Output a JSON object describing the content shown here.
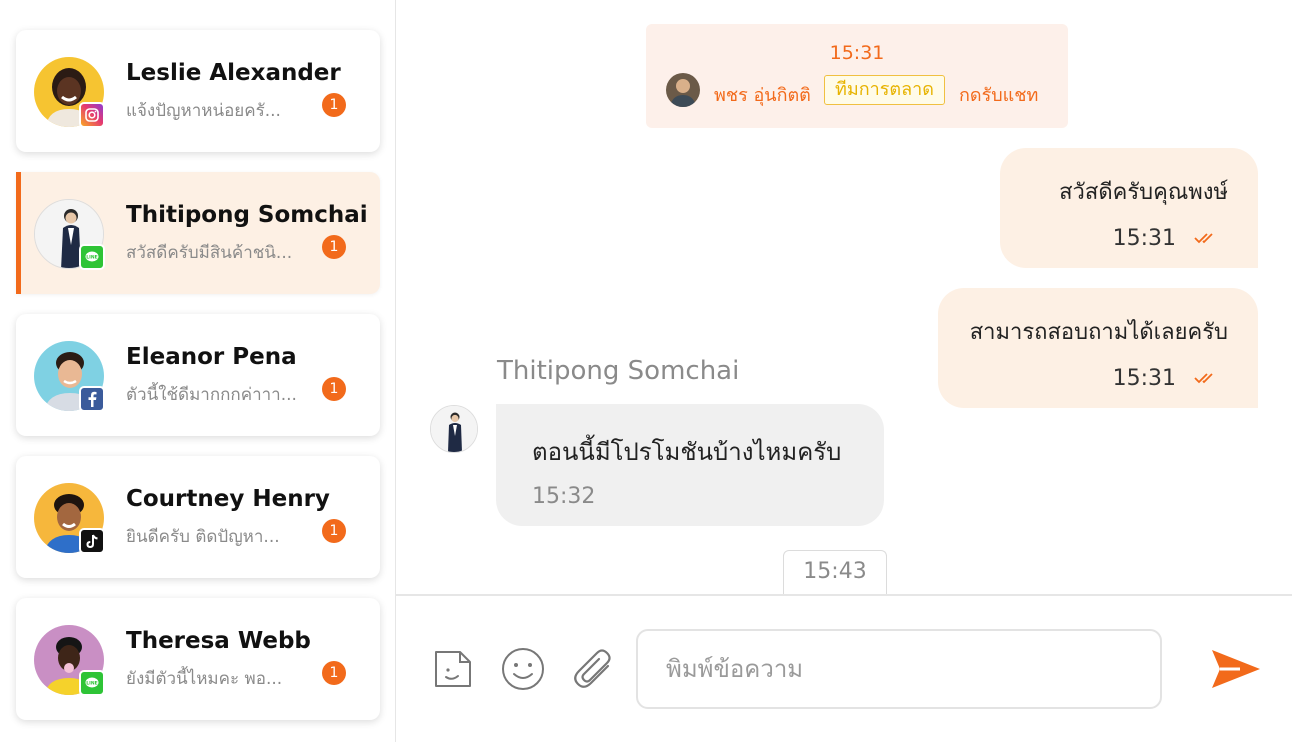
{
  "conversations": [
    {
      "name": "Leslie Alexander",
      "preview": "แจ้งปัญหาหน่อยครั...",
      "unread": "1",
      "channel": "instagram-icon"
    },
    {
      "name": "Thitipong Somchai",
      "preview": "สวัสดีครับมีสินค้าชนิ...",
      "unread": "1",
      "channel": "line-icon",
      "active": true
    },
    {
      "name": "Eleanor Pena",
      "preview": "ตัวนี้ใช้ดีมากกกค่าาา...",
      "unread": "1",
      "channel": "facebook-icon"
    },
    {
      "name": "Courtney Henry",
      "preview": "ยินดีครับ ติดปัญหา...",
      "unread": "1",
      "channel": "tiktok-icon"
    },
    {
      "name": "Theresa Webb",
      "preview": "ยังมีตัวนี้ไหมคะ พอ...",
      "unread": "1",
      "channel": "line-icon"
    }
  ],
  "system_notice": {
    "time": "15:31",
    "agent": "พชร อุ่นกิตติ",
    "team": "ทีมการตลาด",
    "action": "กดรับแชท"
  },
  "messages": {
    "outgoing": [
      {
        "text": "สวัสดีครับคุณพงษ์",
        "time": "15:31"
      },
      {
        "text": "สามารถสอบถามได้เลยครับ",
        "time": "15:31"
      }
    ],
    "incoming": {
      "sender": "Thitipong Somchai",
      "text": "ตอนนี้มีโปรโมชันบ้างไหมครับ",
      "time": "15:32"
    }
  },
  "divider_time": "15:43",
  "composer": {
    "placeholder": "พิมพ์ข้อความ",
    "tools": [
      "sticker-icon",
      "emoji-icon",
      "attachment-icon"
    ],
    "send": "send-icon"
  },
  "colors": {
    "accent": "#f26a1b",
    "active_bg": "#fdf0e4",
    "team_tag": "#e7b300",
    "incoming_bg": "#f0f0f0"
  }
}
